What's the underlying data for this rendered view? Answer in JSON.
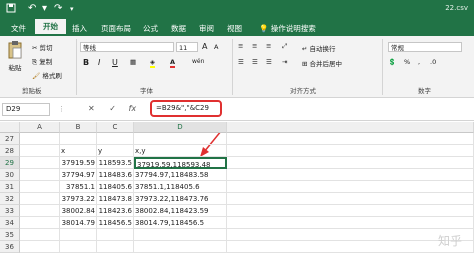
{
  "titlebar": {
    "filename": "22.csv",
    "home_icon": "home-icon",
    "save_icon": "save-icon",
    "undo_icon": "undo-icon",
    "redo_icon": "redo-icon",
    "dropdown_icon": "chevron-down-icon"
  },
  "tabs": [
    "文件",
    "开始",
    "插入",
    "页面布局",
    "公式",
    "数据",
    "审阅",
    "视图"
  ],
  "active_tab": "开始",
  "tell_me": "操作说明搜索",
  "ribbon": {
    "clipboard": {
      "paste": "粘贴",
      "cut": "剪切",
      "copy": "复制",
      "format_painter": "格式刷",
      "label": "剪贴板"
    },
    "font": {
      "font_name": "等线",
      "font_size": "11",
      "grow": "A",
      "shrink": "A",
      "bold": "B",
      "italic": "I",
      "underline": "U",
      "label": "字体",
      "wen": "wén"
    },
    "align": {
      "wrap": "自动换行",
      "merge": "合并后居中",
      "label": "对齐方式"
    },
    "number": {
      "format": "常规",
      "label": "数字"
    }
  },
  "formula_bar": {
    "name_box": "D29",
    "cancel": "✕",
    "enter": "✓",
    "fx": "fx",
    "formula": "=B29&\",\"&C29"
  },
  "columns": [
    "A",
    "B",
    "C",
    "D"
  ],
  "rows": [
    {
      "num": "27",
      "A": "",
      "B": "",
      "C": "",
      "D": ""
    },
    {
      "num": "28",
      "A": "",
      "B": "x",
      "C": "y",
      "D": "x,y"
    },
    {
      "num": "29",
      "A": "",
      "B": "37919.59",
      "C": "118593.5",
      "D": "37919.59,118593.48"
    },
    {
      "num": "30",
      "A": "",
      "B": "37794.97",
      "C": "118483.6",
      "D": "37794.97,118483.58"
    },
    {
      "num": "31",
      "A": "",
      "B": "37851.1",
      "C": "118405.6",
      "D": "37851.1,118405.6"
    },
    {
      "num": "32",
      "A": "",
      "B": "37973.22",
      "C": "118473.8",
      "D": "37973.22,118473.76"
    },
    {
      "num": "33",
      "A": "",
      "B": "38002.84",
      "C": "118423.6",
      "D": "38002.84,118423.59"
    },
    {
      "num": "34",
      "A": "",
      "B": "38014.79",
      "C": "118456.5",
      "D": "38014.79,118456.5"
    },
    {
      "num": "35",
      "A": "",
      "B": "",
      "C": "",
      "D": ""
    },
    {
      "num": "36",
      "A": "",
      "B": "",
      "C": "",
      "D": ""
    }
  ],
  "watermark": "知乎",
  "colors": {
    "excel_green": "#217346",
    "highlight_red": "#e03030"
  }
}
